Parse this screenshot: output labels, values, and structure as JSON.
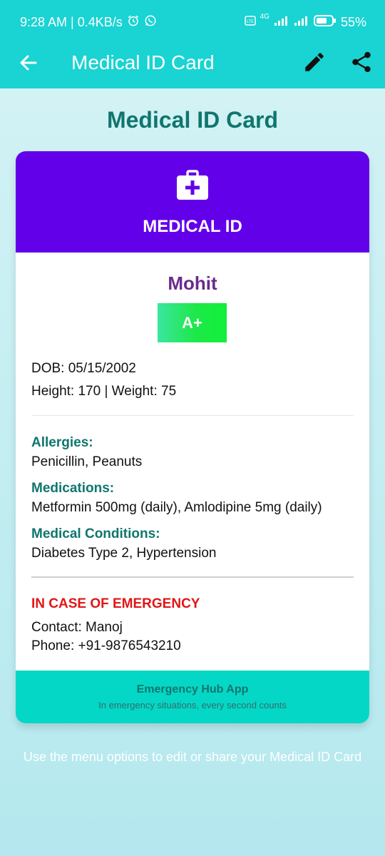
{
  "status_bar": {
    "time_info": "9:28 AM | 0.4KB/s",
    "network": "4G",
    "battery": "55%"
  },
  "app_bar": {
    "title": "Medical ID Card",
    "back_icon": "arrow-left-icon",
    "edit_icon": "pencil-icon",
    "share_icon": "share-icon"
  },
  "page": {
    "title": "Medical ID Card"
  },
  "card": {
    "header_label": "MEDICAL ID",
    "header_icon": "medical-kit-icon",
    "name": "Mohit",
    "blood_group": "A+",
    "dob": "DOB: 05/15/2002",
    "height_weight": "Height: 170 | Weight: 75",
    "allergies_label": "Allergies:",
    "allergies": "Penicillin, Peanuts",
    "medications_label": "Medications:",
    "medications": "Metformin 500mg (daily), Amlodipine 5mg (daily)",
    "conditions_label": "Medical Conditions:",
    "conditions": "Diabetes Type 2, Hypertension",
    "emergency_label": "IN CASE OF EMERGENCY",
    "contact": "Contact: Manoj",
    "phone": "Phone: +91-9876543210",
    "footer_title": "Emergency Hub App",
    "footer_subtitle": "In emergency situations, every second counts"
  },
  "hint_text": "Use the menu options to edit or share your Medical ID Card",
  "colors": {
    "accent_teal": "#1ad3d3",
    "header_purple": "#6200ea",
    "label_teal": "#0f766e",
    "emergency_red": "#e01616",
    "blood_green": "#1de848"
  }
}
